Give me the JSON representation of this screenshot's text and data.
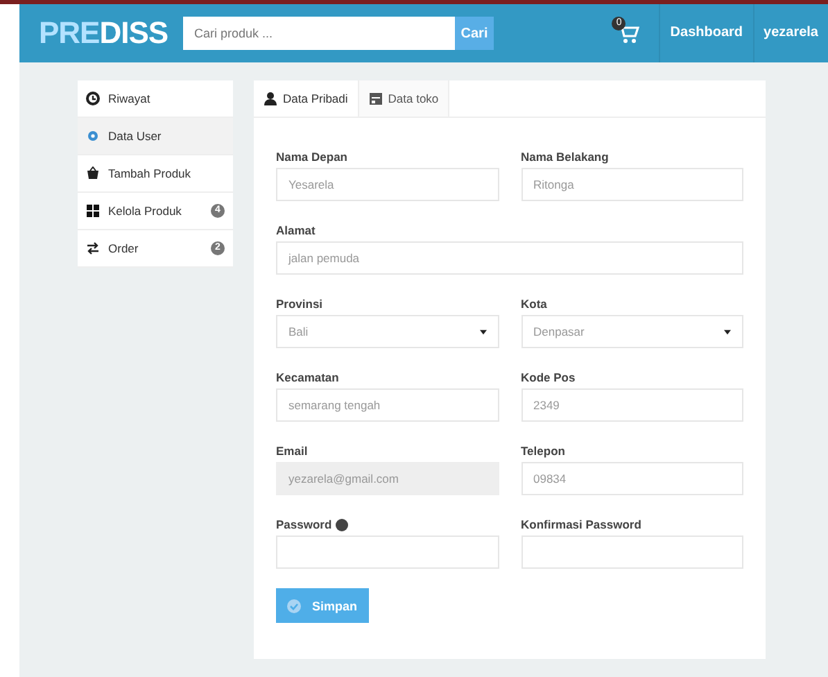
{
  "navbar": {
    "logo": [
      {
        "text": "PRE",
        "kind": "accent"
      },
      {
        "text": "DISS",
        "kind": "plain"
      }
    ],
    "search": {
      "placeholder": "Cari produk ...",
      "button": "Cari"
    },
    "cart_count": "0",
    "links": [
      "Dashboard",
      "yezarela"
    ]
  },
  "sidebar": {
    "items": [
      {
        "label": "Riwayat",
        "selected": false
      },
      {
        "label": "Data User",
        "selected": true
      },
      {
        "label": "Tambah Produk",
        "selected": false
      },
      {
        "label": "Kelola Produk",
        "selected": false,
        "badge": "4"
      },
      {
        "label": "Order",
        "selected": false,
        "badge": "2"
      }
    ]
  },
  "tabs": [
    {
      "label": "Data Pribadi",
      "selected": true
    },
    {
      "label": "Data toko",
      "selected": false
    }
  ],
  "form": {
    "rows": [
      [
        {
          "label": "Nama Depan",
          "kind": "text",
          "value": "Yesarela",
          "disabled": false
        },
        {
          "label": "Nama Belakang",
          "kind": "text",
          "value": "Ritonga",
          "disabled": false
        }
      ],
      [
        {
          "label": "Alamat",
          "kind": "text",
          "value": "jalan pemuda",
          "disabled": false
        }
      ],
      [
        {
          "label": "Provinsi",
          "kind": "select",
          "value": "Bali",
          "disabled": false
        },
        {
          "label": "Kota",
          "kind": "select",
          "value": "Denpasar",
          "disabled": false
        }
      ],
      [
        {
          "label": "Kecamatan",
          "kind": "text",
          "value": "semarang tengah",
          "disabled": false
        },
        {
          "label": "Kode Pos",
          "kind": "text",
          "value": "2349",
          "disabled": false
        }
      ],
      [
        {
          "label": "Email",
          "kind": "text",
          "value": "yezarela@gmail.com",
          "disabled": true
        },
        {
          "label": "Telepon",
          "kind": "text",
          "value": "09834",
          "disabled": false
        }
      ],
      [
        {
          "label": "Password",
          "kind": "password",
          "disabled": false,
          "info": true
        },
        {
          "label": "Konfirmasi Password",
          "kind": "password",
          "disabled": false
        }
      ]
    ],
    "submit": "Simpan"
  }
}
